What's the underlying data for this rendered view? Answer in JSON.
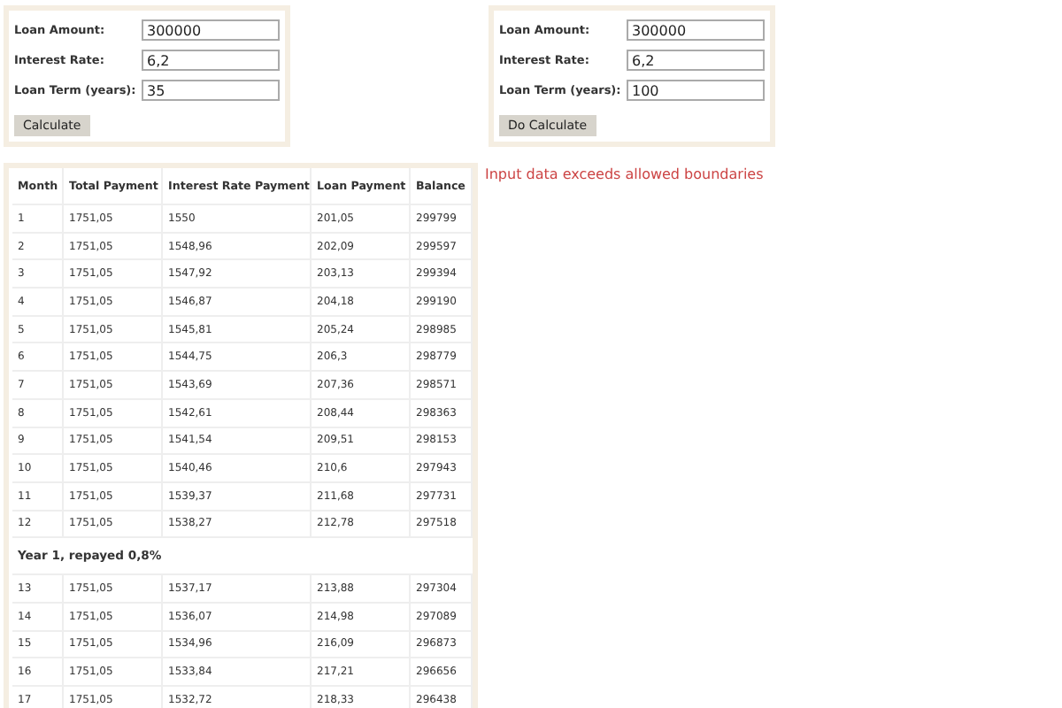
{
  "forms": [
    {
      "fields": [
        {
          "label": "Loan Amount:",
          "value": "300000"
        },
        {
          "label": "Interest Rate:",
          "value": "6,2"
        },
        {
          "label": "Loan Term (years):",
          "value": "35"
        }
      ],
      "button": "Calculate"
    },
    {
      "fields": [
        {
          "label": "Loan Amount:",
          "value": "300000"
        },
        {
          "label": "Interest Rate:",
          "value": "6,2"
        },
        {
          "label": "Loan Term (years):",
          "value": "100"
        }
      ],
      "button": "Do Calculate"
    }
  ],
  "error_message": "Input data exceeds allowed boundaries",
  "table": {
    "columns": [
      "Month",
      "Total Payment",
      "Interest Rate Payment",
      "Loan Payment",
      "Balance"
    ],
    "rows": [
      {
        "kind": "month",
        "cells": [
          "1",
          "1751,05",
          "1550",
          "201,05",
          "299799"
        ]
      },
      {
        "kind": "month",
        "cells": [
          "2",
          "1751,05",
          "1548,96",
          "202,09",
          "299597"
        ]
      },
      {
        "kind": "month",
        "cells": [
          "3",
          "1751,05",
          "1547,92",
          "203,13",
          "299394"
        ]
      },
      {
        "kind": "month",
        "cells": [
          "4",
          "1751,05",
          "1546,87",
          "204,18",
          "299190"
        ]
      },
      {
        "kind": "month",
        "cells": [
          "5",
          "1751,05",
          "1545,81",
          "205,24",
          "298985"
        ]
      },
      {
        "kind": "month",
        "cells": [
          "6",
          "1751,05",
          "1544,75",
          "206,3",
          "298779"
        ]
      },
      {
        "kind": "month",
        "cells": [
          "7",
          "1751,05",
          "1543,69",
          "207,36",
          "298571"
        ]
      },
      {
        "kind": "month",
        "cells": [
          "8",
          "1751,05",
          "1542,61",
          "208,44",
          "298363"
        ]
      },
      {
        "kind": "month",
        "cells": [
          "9",
          "1751,05",
          "1541,54",
          "209,51",
          "298153"
        ]
      },
      {
        "kind": "month",
        "cells": [
          "10",
          "1751,05",
          "1540,46",
          "210,6",
          "297943"
        ]
      },
      {
        "kind": "month",
        "cells": [
          "11",
          "1751,05",
          "1539,37",
          "211,68",
          "297731"
        ]
      },
      {
        "kind": "month",
        "cells": [
          "12",
          "1751,05",
          "1538,27",
          "212,78",
          "297518"
        ]
      },
      {
        "kind": "summary",
        "text": "Year 1, repayed 0,8%"
      },
      {
        "kind": "month",
        "cells": [
          "13",
          "1751,05",
          "1537,17",
          "213,88",
          "297304"
        ]
      },
      {
        "kind": "month",
        "cells": [
          "14",
          "1751,05",
          "1536,07",
          "214,98",
          "297089"
        ]
      },
      {
        "kind": "month",
        "cells": [
          "15",
          "1751,05",
          "1534,96",
          "216,09",
          "296873"
        ]
      },
      {
        "kind": "month",
        "cells": [
          "16",
          "1751,05",
          "1533,84",
          "217,21",
          "296656"
        ]
      },
      {
        "kind": "month",
        "cells": [
          "17",
          "1751,05",
          "1532,72",
          "218,33",
          "296438"
        ]
      }
    ]
  }
}
